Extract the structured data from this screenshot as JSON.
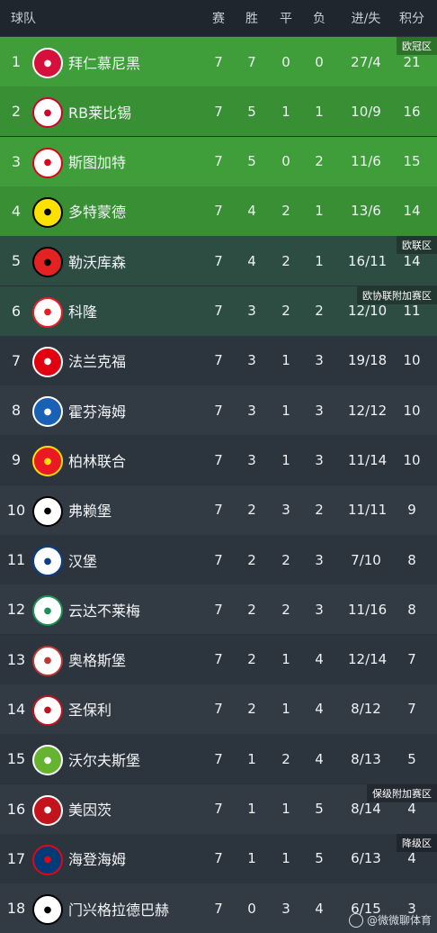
{
  "headers": {
    "team": "球队",
    "played": "赛",
    "won": "胜",
    "drawn": "平",
    "lost": "负",
    "gf_ga": "进/失",
    "points": "积分"
  },
  "colors": {
    "ucl": "#3f9e39",
    "uel": "#2e4d42",
    "base": "#2c343d"
  },
  "teams": [
    {
      "rank": "1",
      "name": "拜仁慕尼黑",
      "p": "7",
      "w": "7",
      "d": "0",
      "l": "0",
      "gd": "27/4",
      "pts": "21",
      "tag": "欧冠区",
      "logo": "bayern-icon",
      "logo_bg": "#d6103a",
      "logo_fg": "#ffffff"
    },
    {
      "rank": "2",
      "name": "RB莱比锡",
      "p": "7",
      "w": "5",
      "d": "1",
      "l": "1",
      "gd": "10/9",
      "pts": "16",
      "tag": "",
      "logo": "leipzig-icon",
      "logo_bg": "#ffffff",
      "logo_fg": "#d4002c"
    },
    {
      "rank": "3",
      "name": "斯图加特",
      "p": "7",
      "w": "5",
      "d": "0",
      "l": "2",
      "gd": "11/6",
      "pts": "15",
      "tag": "",
      "logo": "stuttgart-icon",
      "logo_bg": "#ffffff",
      "logo_fg": "#e2001a"
    },
    {
      "rank": "4",
      "name": "多特蒙德",
      "p": "7",
      "w": "4",
      "d": "2",
      "l": "1",
      "gd": "13/6",
      "pts": "14",
      "tag": "",
      "logo": "dortmund-icon",
      "logo_bg": "#fde100",
      "logo_fg": "#000000"
    },
    {
      "rank": "5",
      "name": "勒沃库森",
      "p": "7",
      "w": "4",
      "d": "2",
      "l": "1",
      "gd": "16/11",
      "pts": "14",
      "tag": "欧联区",
      "logo": "leverkusen-icon",
      "logo_bg": "#e32221",
      "logo_fg": "#000000"
    },
    {
      "rank": "6",
      "name": "科隆",
      "p": "7",
      "w": "3",
      "d": "2",
      "l": "2",
      "gd": "12/10",
      "pts": "11",
      "tag": "欧协联附加赛区",
      "logo": "koln-icon",
      "logo_bg": "#ffffff",
      "logo_fg": "#ed1c24"
    },
    {
      "rank": "7",
      "name": "法兰克福",
      "p": "7",
      "w": "3",
      "d": "1",
      "l": "3",
      "gd": "19/18",
      "pts": "10",
      "tag": "",
      "logo": "frankfurt-icon",
      "logo_bg": "#e1000f",
      "logo_fg": "#ffffff"
    },
    {
      "rank": "8",
      "name": "霍芬海姆",
      "p": "7",
      "w": "3",
      "d": "1",
      "l": "3",
      "gd": "12/12",
      "pts": "10",
      "tag": "",
      "logo": "hoffenheim-icon",
      "logo_bg": "#1961b5",
      "logo_fg": "#ffffff"
    },
    {
      "rank": "9",
      "name": "柏林联合",
      "p": "7",
      "w": "3",
      "d": "1",
      "l": "3",
      "gd": "11/14",
      "pts": "10",
      "tag": "",
      "logo": "union-berlin-icon",
      "logo_bg": "#eb1923",
      "logo_fg": "#fde100"
    },
    {
      "rank": "10",
      "name": "弗赖堡",
      "p": "7",
      "w": "2",
      "d": "3",
      "l": "2",
      "gd": "11/11",
      "pts": "9",
      "tag": "",
      "logo": "freiburg-icon",
      "logo_bg": "#ffffff",
      "logo_fg": "#000000"
    },
    {
      "rank": "11",
      "name": "汉堡",
      "p": "7",
      "w": "2",
      "d": "2",
      "l": "3",
      "gd": "7/10",
      "pts": "8",
      "tag": "",
      "logo": "hamburg-icon",
      "logo_bg": "#ffffff",
      "logo_fg": "#0a3f86"
    },
    {
      "rank": "12",
      "name": "云达不莱梅",
      "p": "7",
      "w": "2",
      "d": "2",
      "l": "3",
      "gd": "11/16",
      "pts": "8",
      "tag": "",
      "logo": "bremen-icon",
      "logo_bg": "#ffffff",
      "logo_fg": "#1d9053"
    },
    {
      "rank": "13",
      "name": "奥格斯堡",
      "p": "7",
      "w": "2",
      "d": "1",
      "l": "4",
      "gd": "12/14",
      "pts": "7",
      "tag": "",
      "logo": "augsburg-icon",
      "logo_bg": "#ffffff",
      "logo_fg": "#ba3733"
    },
    {
      "rank": "14",
      "name": "圣保利",
      "p": "7",
      "w": "2",
      "d": "1",
      "l": "4",
      "gd": "8/12",
      "pts": "7",
      "tag": "",
      "logo": "st-pauli-icon",
      "logo_bg": "#ffffff",
      "logo_fg": "#c4111f"
    },
    {
      "rank": "15",
      "name": "沃尔夫斯堡",
      "p": "7",
      "w": "1",
      "d": "2",
      "l": "4",
      "gd": "8/13",
      "pts": "5",
      "tag": "",
      "logo": "wolfsburg-icon",
      "logo_bg": "#65b32e",
      "logo_fg": "#ffffff"
    },
    {
      "rank": "16",
      "name": "美因茨",
      "p": "7",
      "w": "1",
      "d": "1",
      "l": "5",
      "gd": "8/14",
      "pts": "4",
      "tag": "保级附加赛区",
      "logo": "mainz-icon",
      "logo_bg": "#c3141e",
      "logo_fg": "#ffffff"
    },
    {
      "rank": "17",
      "name": "海登海姆",
      "p": "7",
      "w": "1",
      "d": "1",
      "l": "5",
      "gd": "6/13",
      "pts": "4",
      "tag": "降级区",
      "logo": "heidenheim-icon",
      "logo_bg": "#003b79",
      "logo_fg": "#e30613"
    },
    {
      "rank": "18",
      "name": "门兴格拉德巴赫",
      "p": "7",
      "w": "0",
      "d": "3",
      "l": "4",
      "gd": "6/15",
      "pts": "3",
      "tag": "",
      "logo": "gladbach-icon",
      "logo_bg": "#ffffff",
      "logo_fg": "#000000"
    }
  ],
  "watermark": "@微微聊体育"
}
